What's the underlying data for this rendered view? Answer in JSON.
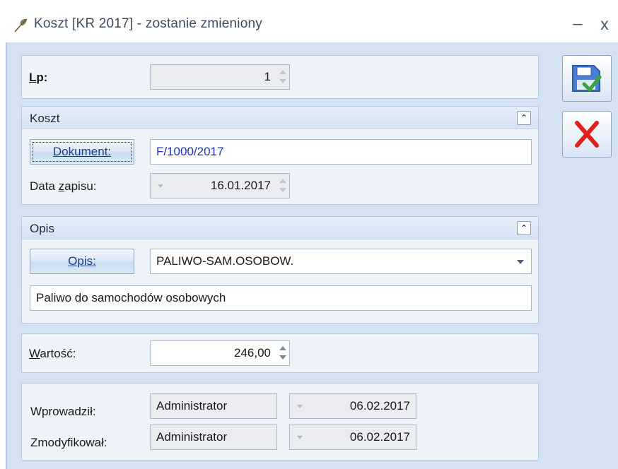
{
  "window": {
    "title": "Koszt [KR 2017] - zostanie zmieniony",
    "minimize_label": "–",
    "close_label": "x"
  },
  "lp": {
    "label": "Lp:",
    "value": "1"
  },
  "koszt_group": {
    "title": "Koszt",
    "collapse_glyph": "«",
    "document_button": "Dokument:",
    "document_value": "F/1000/2017",
    "date_label": "Data zapisu:",
    "date_value": "16.01.2017"
  },
  "opis_group": {
    "title": "Opis",
    "collapse_glyph": "«",
    "opis_button": "Opis:",
    "opis_select_value": "PALIWO-SAM.OSOBOW.",
    "description_value": "Paliwo do samochodów osobowych"
  },
  "wartosc": {
    "label": "Wartość:",
    "value": "246,00"
  },
  "audit": {
    "entered_label": "Wprowadził:",
    "entered_user": "Administrator",
    "entered_date": "06.02.2017",
    "modified_label": "Zmodyfikował:",
    "modified_user": "Administrator",
    "modified_date": "06.02.2017"
  },
  "actions": {
    "save_icon": "save-floppy-check-icon",
    "cancel_icon": "cancel-x-icon"
  },
  "colors": {
    "window_body": "#d4e2f2",
    "panel": "#eef3fa",
    "document_text": "#1a2fd4",
    "cancel_red": "#e0201b",
    "check_green": "#3aa63a"
  }
}
